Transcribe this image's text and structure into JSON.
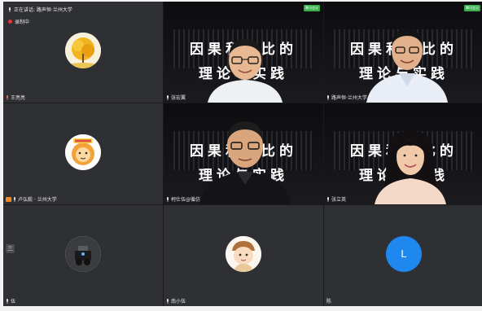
{
  "meeting": {
    "speaking_label": "正在讲话: 路声恒·兰州大学",
    "recording_label": "录制中",
    "side_button_label": "三"
  },
  "slide": {
    "line1": "因果和类比的",
    "line2": "理论与实践",
    "tag": "腾讯会议"
  },
  "participants": [
    {
      "name": "王亮亮"
    },
    {
      "name": "张宏翼"
    },
    {
      "name": "路声恒·兰州大学"
    },
    {
      "name": "卢弘毅 · 兰州大学"
    },
    {
      "name": "柯仕伍@循仿"
    },
    {
      "name": "张立英"
    },
    {
      "name": "伍"
    },
    {
      "name": "南小伍"
    },
    {
      "name": "陈",
      "avatar_letter": "L"
    }
  ],
  "colors": {
    "tile_bg": "#2f3034",
    "avatar_blue": "#1e87f0",
    "recording_red": "#e23a3a",
    "badge_green": "#35b04a",
    "host_orange": "#f08a1c"
  }
}
